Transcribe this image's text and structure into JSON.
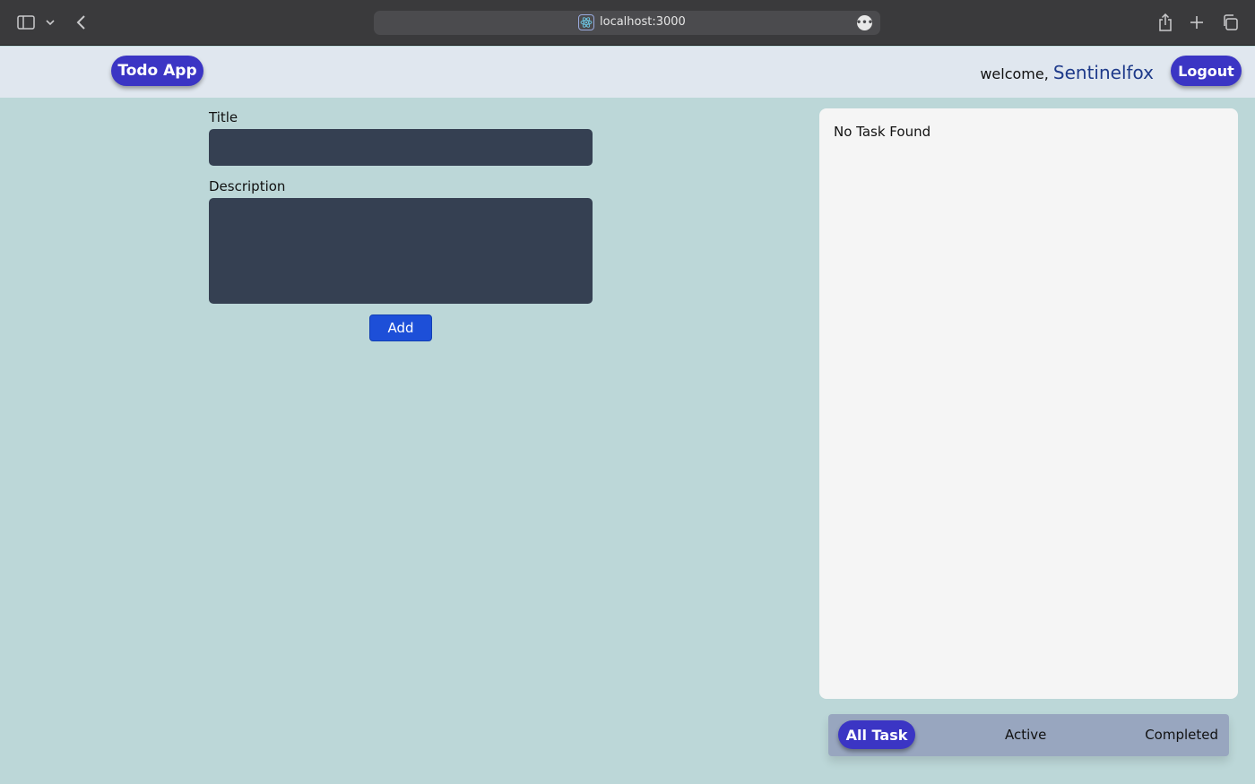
{
  "browser": {
    "url": "localhost:3000",
    "site_icon": "react-icon",
    "more_icon": "ellipsis-icon"
  },
  "navbar": {
    "brand": "Todo App",
    "welcome_prefix": "welcome,",
    "username": "Sentinelfox",
    "logout_label": "Logout"
  },
  "form": {
    "title_label": "Title",
    "title_value": "",
    "description_label": "Description",
    "description_value": "",
    "add_label": "Add"
  },
  "tasks": {
    "empty_message": "No Task Found",
    "items": []
  },
  "filters": {
    "items": [
      "All Task",
      "Active",
      "Completed"
    ],
    "selected": "All Task"
  },
  "colors": {
    "page_bg": "#bcd7d8",
    "navbar_bg": "#e0e7ef",
    "accent": "#3b35c4",
    "add_button": "#1d4fd8",
    "input_bg": "#354052",
    "panel_bg": "#f5f5f5",
    "filter_bar_bg": "#98a6bf"
  }
}
